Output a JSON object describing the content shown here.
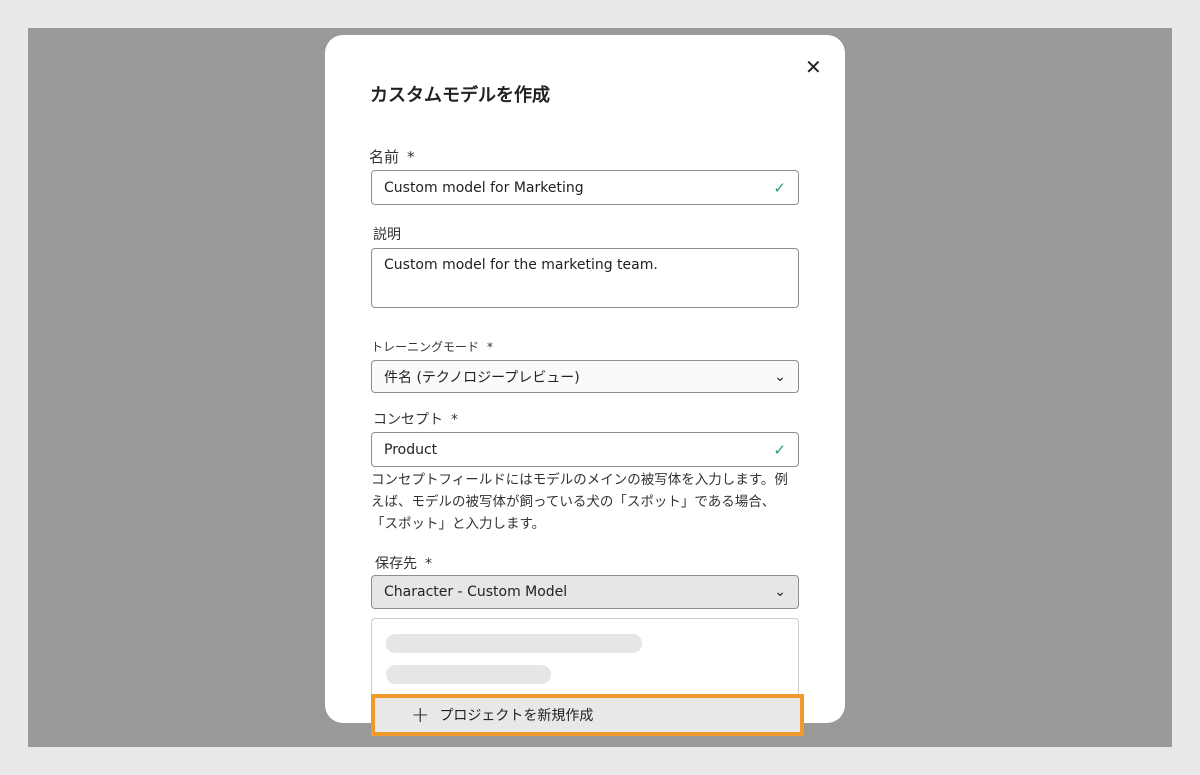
{
  "dialog": {
    "title": "カスタムモデルを作成",
    "close_icon": "close-icon",
    "required_mark": "*",
    "name": {
      "label": "名前",
      "value": "Custom model for Marketing",
      "status": "valid"
    },
    "description": {
      "label": "説明",
      "value": "Custom model for the marketing team."
    },
    "training_mode": {
      "label": "トレーニングモード",
      "value": "件名 (テクノロジープレビュー)"
    },
    "concept": {
      "label": "コンセプト",
      "value": "Product",
      "status": "valid",
      "help": "コンセプトフィールドにはモデルのメインの被写体を入力します。例えば、モデルの被写体が飼っている犬の「スポット」である場合、「スポット」と入力します。"
    },
    "destination": {
      "label": "保存先",
      "value": "Character - Custom Model",
      "menu": {
        "new_project_label": "プロジェクトを新規作成",
        "new_project_icon": "plus-icon"
      }
    }
  },
  "colors": {
    "highlight": "#ef9a2c",
    "valid": "#2d9d78"
  }
}
